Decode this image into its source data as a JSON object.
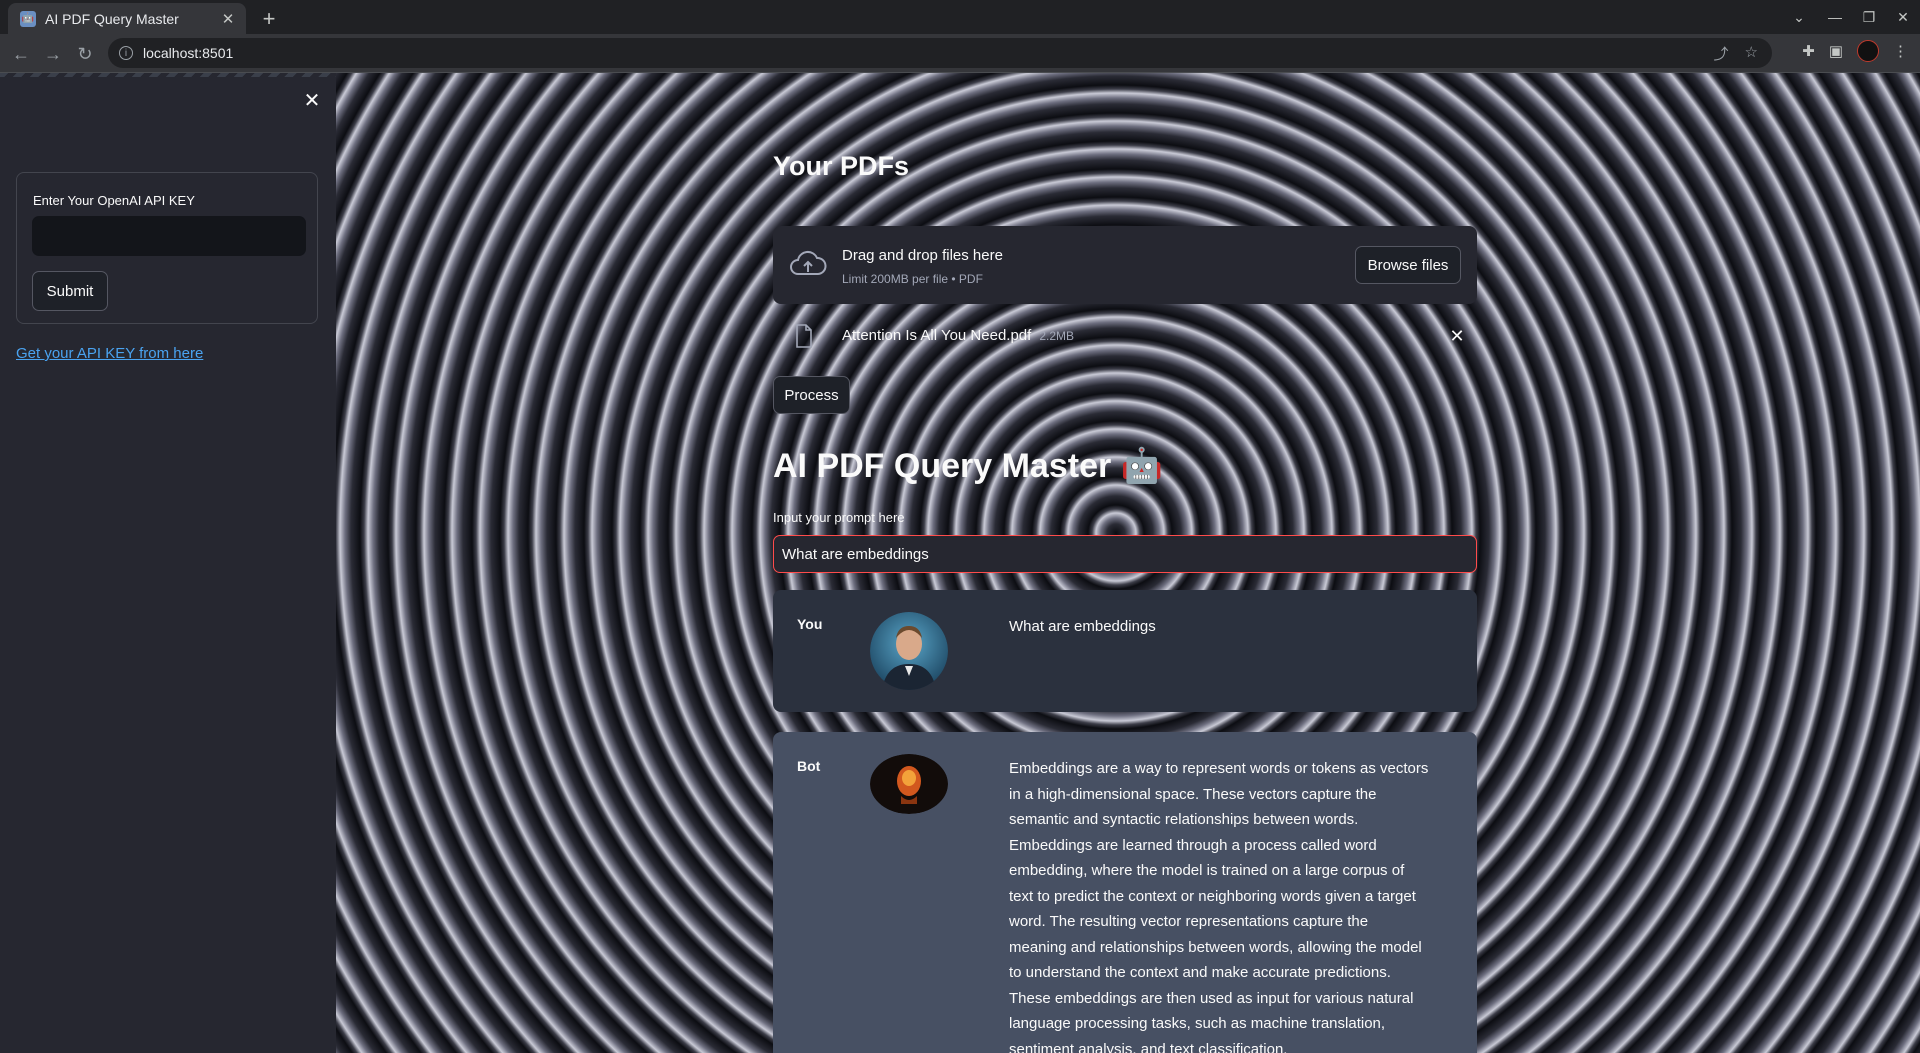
{
  "browser": {
    "tab_title": "AI PDF Query Master",
    "url": "localhost:8501"
  },
  "sidebar": {
    "api_key_label": "Enter Your OpenAI API KEY",
    "api_key_value": "",
    "submit_label": "Submit",
    "api_link_text": "Get your API KEY from here"
  },
  "main": {
    "pdfs_heading": "Your PDFs",
    "uploader": {
      "drop_title": "Drag and drop files here",
      "limit_text": "Limit 200MB per file • PDF",
      "browse_label": "Browse files"
    },
    "file": {
      "name": "Attention Is All You Need.pdf",
      "size": "2.2MB"
    },
    "process_label": "Process",
    "app_title": "AI PDF Query Master 🤖",
    "prompt_label": "Input your prompt here",
    "prompt_value": "What are embeddings",
    "messages": [
      {
        "who": "You",
        "text": "What are embeddings"
      },
      {
        "who": "Bot",
        "text": "Embeddings are a way to represent words or tokens as vectors in a high-dimensional space. These vectors capture the semantic and syntactic relationships between words. Embeddings are learned through a process called word embedding, where the model is trained on a large corpus of text to predict the context or neighboring words given a target word. The resulting vector representations capture the meaning and relationships between words, allowing the model to understand the context and make accurate predictions. These embeddings are then used as input for various natural language processing tasks, such as machine translation, sentiment analysis, and text classification."
      }
    ]
  },
  "colors": {
    "accent": "#ff4b4b",
    "link": "#4aa3f0",
    "sidebar_bg": "#262730",
    "user_msg_bg": "#2b313e",
    "bot_msg_bg": "#475063"
  }
}
